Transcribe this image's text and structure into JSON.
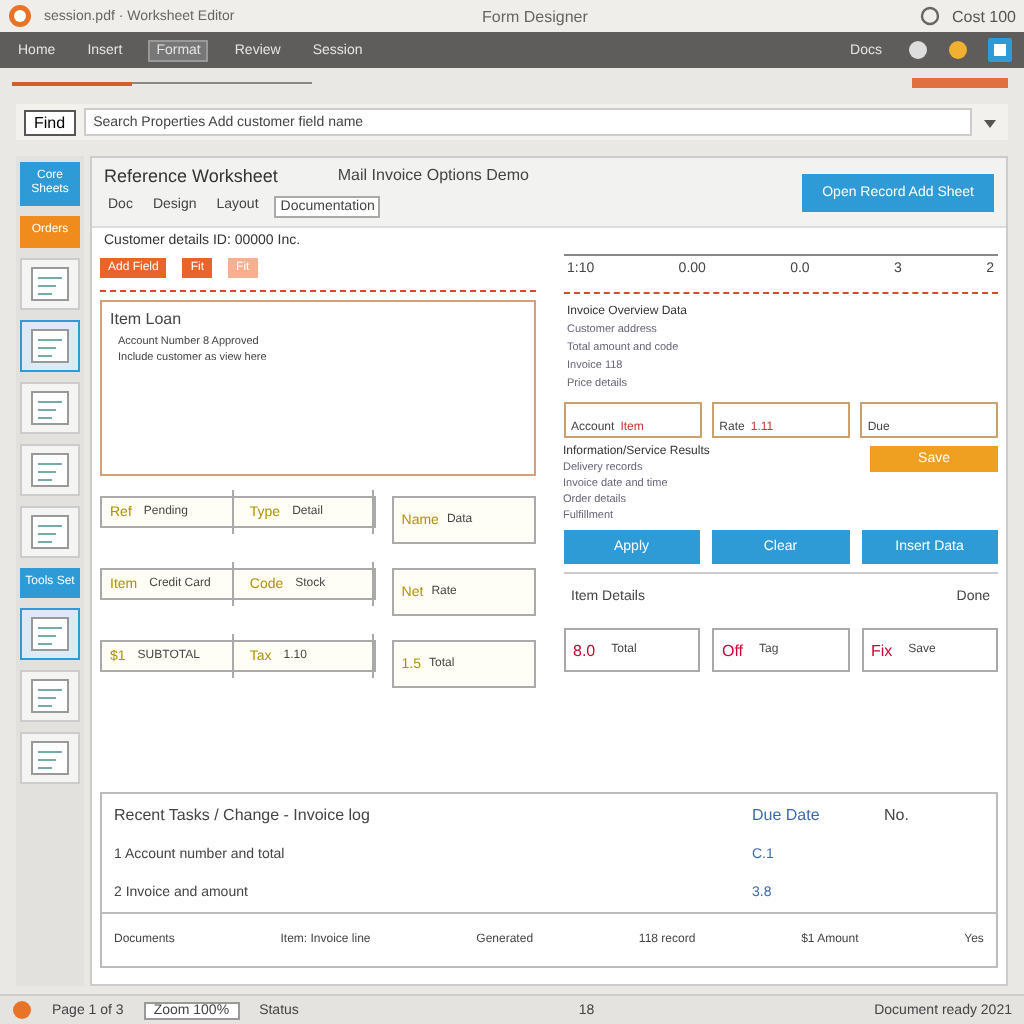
{
  "window": {
    "title": "Form Designer",
    "document": "session.pdf · Worksheet Editor",
    "right_label": "Cost 100"
  },
  "menu": [
    {
      "label": "Home",
      "selected": false
    },
    {
      "label": "Insert",
      "selected": false
    },
    {
      "label": "Format",
      "selected": true
    },
    {
      "label": "Review",
      "selected": false
    },
    {
      "label": "Session",
      "selected": false
    }
  ],
  "menu_right": "Docs",
  "address": {
    "button": "Find",
    "value": "Search   Properties      Add customer field name"
  },
  "sidebar": [
    {
      "kind": "tile",
      "label": "Core Sheets",
      "color": "#2e9ad6"
    },
    {
      "kind": "tile",
      "label": "Orders",
      "color": "#f08c1e"
    },
    {
      "kind": "thumb",
      "selected": false
    },
    {
      "kind": "thumb",
      "selected": true
    },
    {
      "kind": "thumb",
      "selected": false
    },
    {
      "kind": "thumb",
      "selected": false
    },
    {
      "kind": "thumb",
      "selected": false
    },
    {
      "kind": "tile",
      "label": "Tools Set",
      "color": "#2e9ad6"
    },
    {
      "kind": "thumb",
      "selected": true
    },
    {
      "kind": "thumb",
      "selected": false
    },
    {
      "kind": "thumb",
      "selected": false
    }
  ],
  "header": {
    "title": "Reference Worksheet",
    "subtitle": "Mail Invoice Options  Demo",
    "action": "Open Record Add Sheet"
  },
  "tabs": [
    {
      "label": "Doc",
      "selected": false
    },
    {
      "label": "Design",
      "selected": false
    },
    {
      "label": "Layout",
      "selected": false
    },
    {
      "label": "Documentation",
      "selected": true
    }
  ],
  "section": "Customer details ID: 00000 Inc.",
  "tools": [
    {
      "kind": "primary",
      "label": "Add Field"
    },
    {
      "kind": "small",
      "label": "Fit"
    },
    {
      "kind": "outline",
      "label": "Fit"
    }
  ],
  "ruler": [
    "1:10",
    "0.00",
    "0.0",
    "3",
    "2"
  ],
  "editor": {
    "heading": "Item Loan",
    "lines": [
      "Account Number 8 Approved",
      "Include customer as view here"
    ]
  },
  "info": {
    "title": "Invoice Overview Data",
    "lines": [
      "Customer address",
      "Total amount and code",
      "Invoice 118",
      "Price details"
    ]
  },
  "fields": [
    {
      "label": "Account",
      "value": "Item"
    },
    {
      "label": "Rate",
      "value": "1.11"
    },
    {
      "label": "Due"
    }
  ],
  "save": "Save",
  "results": {
    "title": "Information/Service Results",
    "lines": [
      "Delivery records",
      "Invoice date and time",
      "Order details",
      "Fulfillment"
    ]
  },
  "actions": [
    "Apply",
    "Clear",
    "Insert Data"
  ],
  "cards": [
    [
      {
        "label": "Ref",
        "value": "Pending"
      },
      {
        "label": "Type",
        "value": "Detail"
      },
      {
        "label": "Name",
        "value": "Data"
      }
    ],
    [
      {
        "label": "Item",
        "value": "Credit Card"
      },
      {
        "label": "Code",
        "value": "Stock"
      },
      {
        "label": "Net",
        "value": "Rate"
      }
    ],
    [
      {
        "label": "$1",
        "value": "SUBTOTAL"
      },
      {
        "label": "Tax",
        "value": "1.10"
      },
      {
        "label": "1.5",
        "value": "Total"
      }
    ]
  ],
  "detail": {
    "label": "Item Details",
    "value": "Done"
  },
  "chips": [
    {
      "label": "8.0",
      "value": "Total"
    },
    {
      "label": "Off",
      "value": "Tag"
    },
    {
      "label": "Fix",
      "value": "Save"
    }
  ],
  "table": {
    "columns": [
      "Recent Tasks  /  Change - Invoice log",
      "Due Date",
      "No."
    ],
    "rows": [
      {
        "cells": [
          "1  Account number and total",
          "C.1"
        ]
      },
      {
        "cells": [
          "2  Invoice and amount",
          "3.8"
        ]
      }
    ],
    "footer": [
      "Documents",
      "Item: Invoice line",
      "Generated",
      "118 record",
      "$1 Amount",
      "Yes"
    ]
  },
  "status": {
    "page": "Page 1 of 3",
    "zoom": "Zoom 100%",
    "mode": "Status",
    "count": "18",
    "right": "Document ready 2021"
  }
}
